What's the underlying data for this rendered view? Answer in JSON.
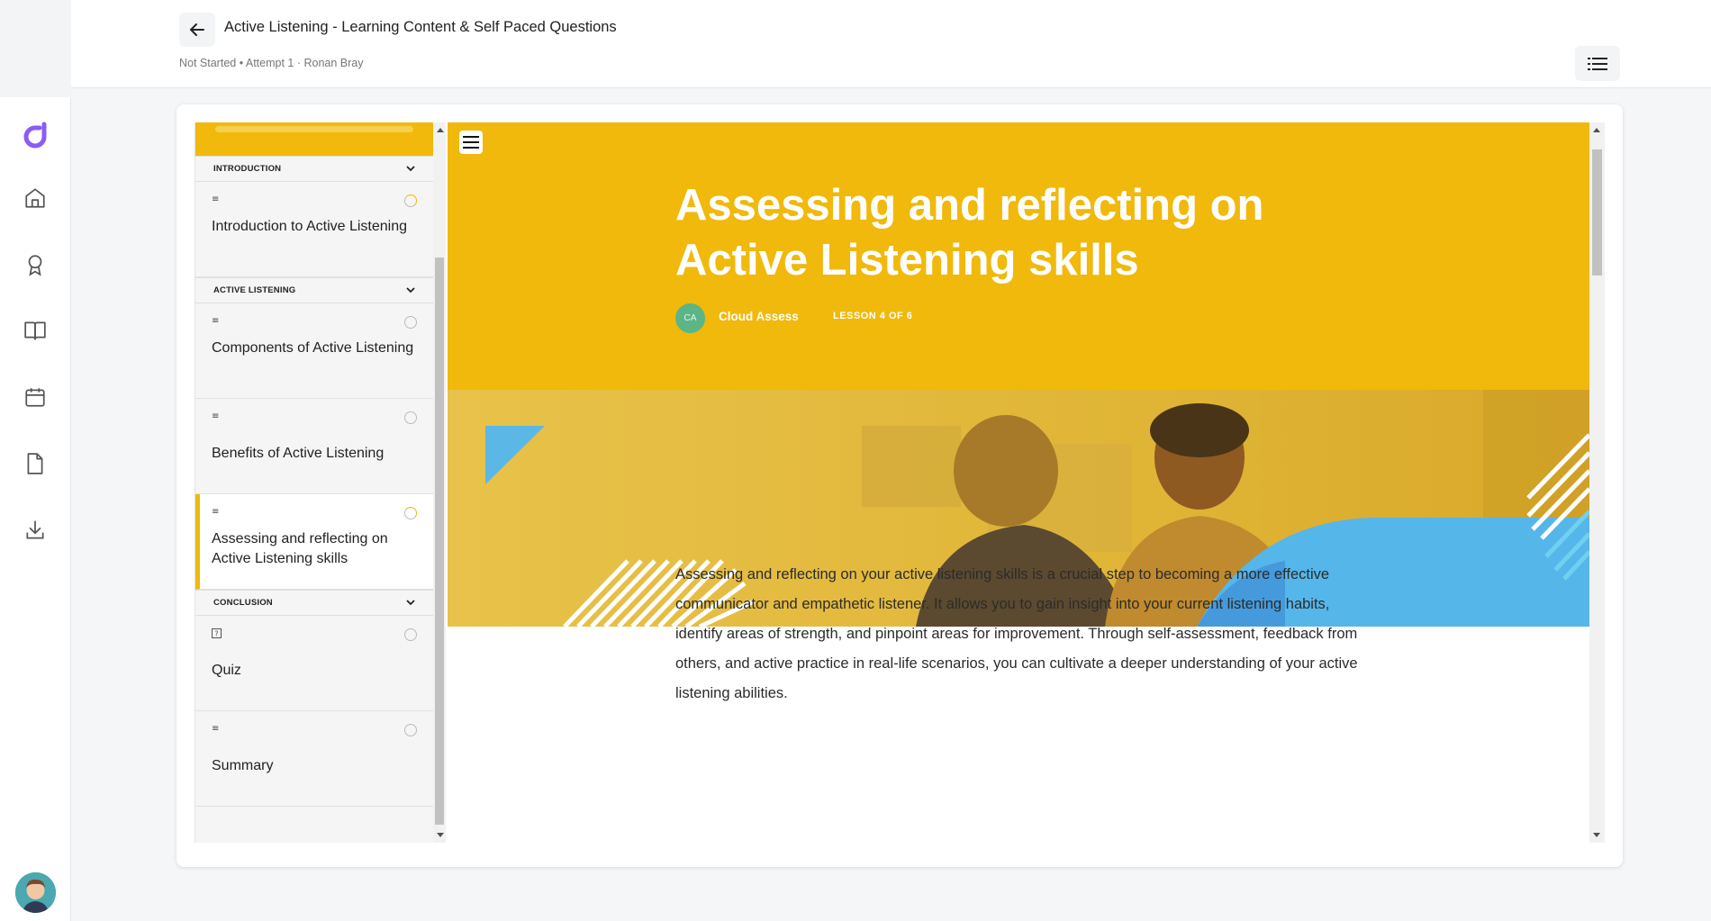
{
  "header": {
    "title": "Active Listening - Learning Content & Self Paced Questions",
    "meta": "Not Started • Attempt 1 · Ronan Bray"
  },
  "rail": {
    "icons": [
      "home-icon",
      "award-icon",
      "book-icon",
      "calendar-icon",
      "file-icon",
      "download-icon"
    ]
  },
  "outline": {
    "sections": [
      {
        "title": "INTRODUCTION"
      },
      {
        "title": "ACTIVE LISTENING"
      },
      {
        "title": "CONCLUSION"
      }
    ],
    "lessons": [
      {
        "title": "Introduction to Active Listening",
        "status": "in-progress"
      },
      {
        "title": "Components of Active Listening",
        "status": "not-started"
      },
      {
        "title": "Benefits of Active Listening",
        "status": "not-started"
      },
      {
        "title": "Assessing and reflecting on Active Listening skills",
        "status": "in-progress",
        "active": true
      },
      {
        "title": "Quiz",
        "status": "not-started"
      },
      {
        "title": "Summary",
        "status": "not-started"
      }
    ]
  },
  "lesson": {
    "title": "Assessing and reflecting on Active Listening skills",
    "author_initials": "CA",
    "author": "Cloud Assess",
    "counter": "LESSON 4 OF 6",
    "body": "Assessing and reflecting on your active listening skills is a crucial step to becoming a more effective communicator and empathetic listener. It allows you to gain insight into your current listening habits, identify areas of strength, and pinpoint areas for improvement. Through self-assessment, feedback from others, and active practice in real-life scenarios, you can cultivate a deeper understanding of your active listening abilities."
  },
  "colors": {
    "accent": "#f0b90b",
    "brand": "#7b5cf0",
    "hero_shape": "#55b8e6"
  }
}
